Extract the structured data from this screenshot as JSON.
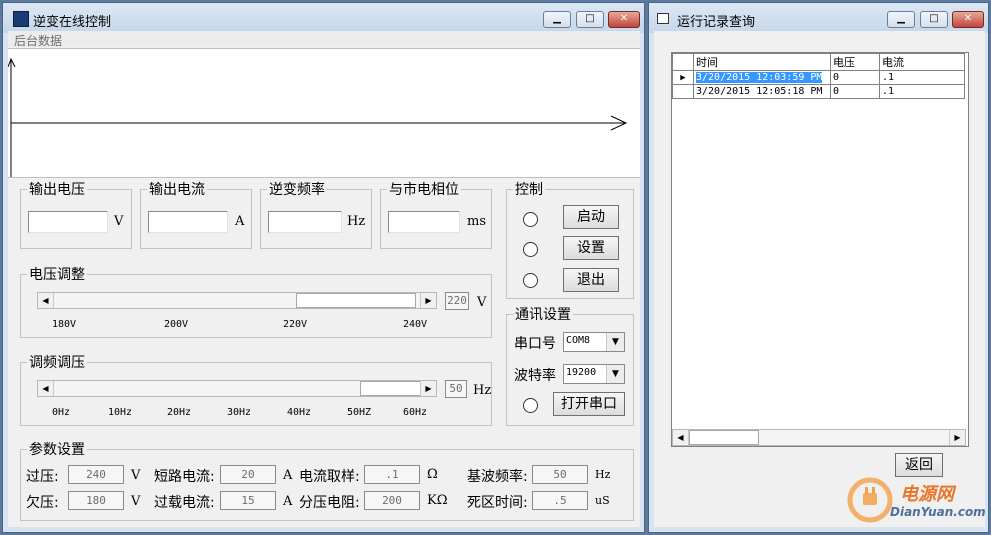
{
  "left_window": {
    "title": "逆变在线控制",
    "menu": [
      "后台数据"
    ],
    "output_voltage": {
      "label": "输出电压",
      "value": "",
      "unit": "V"
    },
    "output_current": {
      "label": "输出电流",
      "value": "",
      "unit": "A"
    },
    "inverter_freq": {
      "label": "逆变频率",
      "value": "",
      "unit": "Hz"
    },
    "grid_phase": {
      "label": "与市电相位",
      "value": "",
      "unit": "ms"
    },
    "control": {
      "label": "控制",
      "start": "启动",
      "settings": "设置",
      "exit": "退出"
    },
    "voltage_adjust": {
      "label": "电压调整",
      "value": "220",
      "unit": "V",
      "ticks": [
        "180V",
        "200V",
        "220V",
        "240V"
      ],
      "slider_fraction": 0.67
    },
    "freq_adjust": {
      "label": "调频调压",
      "value": "50",
      "unit": "Hz",
      "ticks": [
        "0Hz",
        "10Hz",
        "20Hz",
        "30Hz",
        "40Hz",
        "50HZ",
        "60Hz"
      ],
      "slider_fraction": 0.83
    },
    "comm": {
      "label": "通讯设置",
      "port_label": "串口号",
      "port_value": "COM8",
      "baud_label": "波特率",
      "baud_value": "19200",
      "open_button": "打开串口"
    },
    "params": {
      "label": "参数设置",
      "over_voltage": {
        "label": "过压:",
        "value": "240",
        "unit": "V"
      },
      "under_voltage": {
        "label": "欠压:",
        "value": "180",
        "unit": "V"
      },
      "short_current": {
        "label": "短路电流:",
        "value": "20",
        "unit": "A"
      },
      "overload_current": {
        "label": "过载电流:",
        "value": "15",
        "unit": "A"
      },
      "current_sampling": {
        "label": "电流取样:",
        "value": ".1",
        "unit": "Ω"
      },
      "divider_resistor": {
        "label": "分压电阻:",
        "value": "200",
        "unit": "KΩ"
      },
      "fundamental_freq": {
        "label": "基波频率:",
        "value": "50",
        "unit": "Hz"
      },
      "dead_time": {
        "label": "死区时间:",
        "value": ".5",
        "unit": "uS"
      }
    }
  },
  "right_window": {
    "title": "运行记录查询",
    "columns": [
      "时间",
      "电压",
      "电流"
    ],
    "rows": [
      [
        "3/20/2015 12:03:59 PM",
        "0",
        ".1"
      ],
      [
        "3/20/2015 12:05:18 PM",
        "0",
        ".1"
      ]
    ],
    "back_button": "返回"
  },
  "watermark": {
    "cn": "电源网",
    "en": "DianYuan.com"
  },
  "colors": {
    "selection": "#3399ff",
    "title_bar": "#c6d7ea",
    "close_button": "#c0443a"
  }
}
